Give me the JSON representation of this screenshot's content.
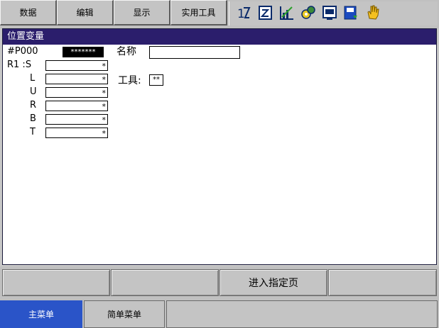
{
  "menu": [
    {
      "label": "数据"
    },
    {
      "label": "编辑"
    },
    {
      "label": "显示"
    },
    {
      "label": "实用工具"
    }
  ],
  "toolbar_icons": [
    "axis-order-icon",
    "edit-icon",
    "chart-icon",
    "gears-icon",
    "monitor-icon",
    "save-icon",
    "hand-icon"
  ],
  "panel": {
    "title": "位置变量",
    "variable_label": "#P000",
    "variable_value": "*******",
    "name_label": "名称",
    "name_value": "",
    "tool_label": "工具:",
    "tool_value": "**",
    "robot_label": "R1 :S",
    "axes": [
      {
        "label": "L",
        "value": "*"
      },
      {
        "label": "U",
        "value": "*"
      },
      {
        "label": "R",
        "value": "*"
      },
      {
        "label": "B",
        "value": "*"
      },
      {
        "label": "T",
        "value": "*"
      }
    ],
    "s_value": "*"
  },
  "function_buttons": [
    "",
    "",
    "进入指定页",
    ""
  ],
  "bottom_tabs": {
    "main": "主菜单",
    "simple": "简单菜单"
  },
  "colors": {
    "title_bar": "#2b1e6c",
    "main_tab": "#2a54c8",
    "background": "#c0c0c0"
  }
}
